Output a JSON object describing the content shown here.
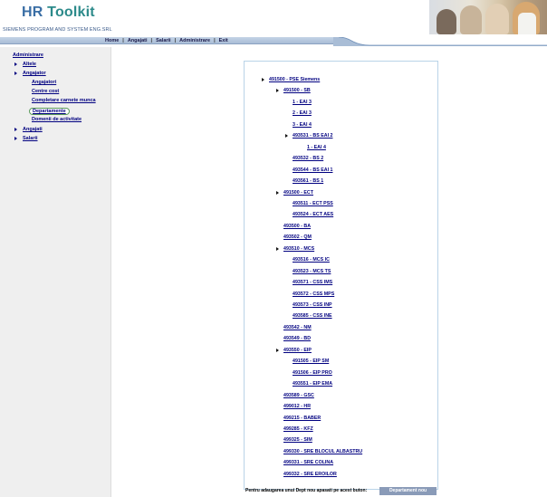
{
  "header": {
    "brand_hr": "HR",
    "brand_toolkit": " Toolkit",
    "company": "SIEMENS PROGRAM AND SYSTEM ENG.SRL"
  },
  "nav": {
    "items": [
      "Home",
      "Angajati",
      "Salarii",
      "Administrare",
      "Exit"
    ]
  },
  "sidebar": {
    "items": [
      {
        "label": "Administrare",
        "level": 0,
        "bullet": false
      },
      {
        "label": "Altele",
        "level": 1,
        "bullet": true
      },
      {
        "label": "Angajator",
        "level": 1,
        "bullet": true
      },
      {
        "label": "Angajatori",
        "level": 2,
        "bullet": false
      },
      {
        "label": "Centre cost",
        "level": 2,
        "bullet": false
      },
      {
        "label": "Completare carnete munca",
        "level": 2,
        "bullet": false
      },
      {
        "label": "Departamente",
        "level": 2,
        "bullet": false,
        "selected": true
      },
      {
        "label": "Domenii de activitate",
        "level": 2,
        "bullet": false
      },
      {
        "label": "Angajati",
        "level": 1,
        "bullet": true
      },
      {
        "label": "Salarii",
        "level": 1,
        "bullet": true
      }
    ]
  },
  "tree": {
    "items": [
      {
        "label": "491500 - PSE Siemens",
        "level": 0,
        "arrow": true
      },
      {
        "label": "491500 - SB",
        "level": 1,
        "arrow": true
      },
      {
        "label": "1 - EAI 3",
        "level": 2,
        "arrow": false
      },
      {
        "label": "2 - EAI 3",
        "level": 2,
        "arrow": false
      },
      {
        "label": "3 - EAI 4",
        "level": 2,
        "arrow": false
      },
      {
        "label": "493531 - BS EAI 2",
        "level": 2,
        "arrow": true
      },
      {
        "label": "1 - EAI 4",
        "level": 3,
        "arrow": false
      },
      {
        "label": "493532 - BS 2",
        "level": 2,
        "arrow": false
      },
      {
        "label": "493544 - BS EAI 1",
        "level": 2,
        "arrow": false
      },
      {
        "label": "493561 - BS 1",
        "level": 2,
        "arrow": false
      },
      {
        "label": "491500 - ECT",
        "level": 1,
        "arrow": true
      },
      {
        "label": "493511 - ECT PSS",
        "level": 2,
        "arrow": false
      },
      {
        "label": "493524 - ECT AES",
        "level": 2,
        "arrow": false
      },
      {
        "label": "493500 - BA",
        "level": 1,
        "arrow": false
      },
      {
        "label": "493502 - QM",
        "level": 1,
        "arrow": false
      },
      {
        "label": "493510 - MCS",
        "level": 1,
        "arrow": true
      },
      {
        "label": "493516 - MCS IC",
        "level": 2,
        "arrow": false
      },
      {
        "label": "493523 - MCS TS",
        "level": 2,
        "arrow": false
      },
      {
        "label": "493571 - CSS IMS",
        "level": 2,
        "arrow": false
      },
      {
        "label": "493572 - CSS MPS",
        "level": 2,
        "arrow": false
      },
      {
        "label": "493573 - CSS INP",
        "level": 2,
        "arrow": false
      },
      {
        "label": "493585 - CSS INE",
        "level": 2,
        "arrow": false
      },
      {
        "label": "493542 - NM",
        "level": 1,
        "arrow": false
      },
      {
        "label": "493549 - BD",
        "level": 1,
        "arrow": false
      },
      {
        "label": "493550 - EIP",
        "level": 1,
        "arrow": true
      },
      {
        "label": "491505 - EIP SM",
        "level": 2,
        "arrow": false
      },
      {
        "label": "491506 - EIP PRO",
        "level": 2,
        "arrow": false
      },
      {
        "label": "493551 - EIP EMA",
        "level": 2,
        "arrow": false
      },
      {
        "label": "493589 - GSC",
        "level": 1,
        "arrow": false
      },
      {
        "label": "499012 - HR",
        "level": 1,
        "arrow": false
      },
      {
        "label": "499215 - BABER",
        "level": 1,
        "arrow": false
      },
      {
        "label": "499285 - KFZ",
        "level": 1,
        "arrow": false
      },
      {
        "label": "499325 - SIM",
        "level": 1,
        "arrow": false
      },
      {
        "label": "499330 - SRE BLOCUL ALBASTRU",
        "level": 1,
        "arrow": false
      },
      {
        "label": "499331 - SRE COLINA",
        "level": 1,
        "arrow": false
      },
      {
        "label": "499332 - SRE EROILOR",
        "level": 1,
        "arrow": false
      }
    ]
  },
  "footer": {
    "hint": "Pentru adaugarea unui Dept nou apasati pe acest buton:",
    "new_button": "Departament nou"
  },
  "colors": {
    "link": "#000080",
    "nav_bar": "#b3c5dc",
    "brand_blue": "#3a6ea5",
    "brand_teal": "#2c8a8a",
    "button": "#8a9bb8"
  }
}
